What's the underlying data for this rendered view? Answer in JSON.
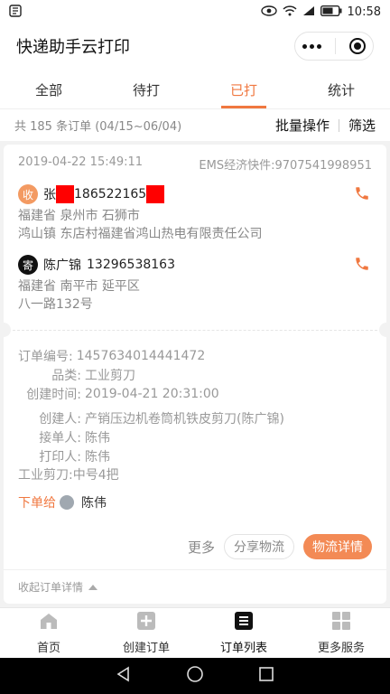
{
  "status_bar": {
    "time": "10:58"
  },
  "header": {
    "title": "快递助手云打印"
  },
  "tabs": [
    {
      "label": "全部"
    },
    {
      "label": "待打"
    },
    {
      "label": "已打"
    },
    {
      "label": "统计"
    }
  ],
  "summary": {
    "text": "共 185 条订单 (04/15~06/04)",
    "batch_label": "批量操作",
    "filter_label": "筛选"
  },
  "order": {
    "datetime": "2019-04-22 15:49:11",
    "tracking": "EMS经济快件:9707541998951",
    "recipient": {
      "badge": "收",
      "name_visible": "张",
      "phone_visible": "186522165",
      "address_line1": "福建省 泉州市 石狮市",
      "address_line2": "鸿山镇 东店村福建省鸿山热电有限责任公司"
    },
    "sender": {
      "badge": "寄",
      "name": "陈广锦",
      "phone": "13296538163",
      "address_line1": "福建省 南平市 延平区",
      "address_line2": "八一路132号"
    },
    "details": [
      {
        "key": "订单编号:",
        "value": "1457634014441472"
      },
      {
        "key": "品类:",
        "value": "工业剪刀"
      },
      {
        "key": "创建时间:",
        "value": "2019-04-21 20:31:00"
      }
    ],
    "people": [
      {
        "key": "创建人:",
        "value": "产销压边机卷筒机铁皮剪刀(陈广锦)"
      },
      {
        "key": "接单人:",
        "value": "陈伟"
      },
      {
        "key": "打印人:",
        "value": "陈伟"
      }
    ],
    "remark": "工业剪刀:中号4把",
    "assign_label": "下单给",
    "assign_name": "陈伟",
    "more_label": "更多",
    "share_label": "分享物流",
    "detail_label": "物流详情",
    "collapse_label": "收起订单详情"
  },
  "bottom_nav": [
    {
      "label": "首页",
      "icon": "home-icon"
    },
    {
      "label": "创建订单",
      "icon": "add-order-icon"
    },
    {
      "label": "订单列表",
      "icon": "order-list-icon"
    },
    {
      "label": "更多服务",
      "icon": "grid-icon"
    }
  ],
  "colors": {
    "accent": "#f07840",
    "primary_button": "#f38a55",
    "redaction": "#ff0000"
  }
}
